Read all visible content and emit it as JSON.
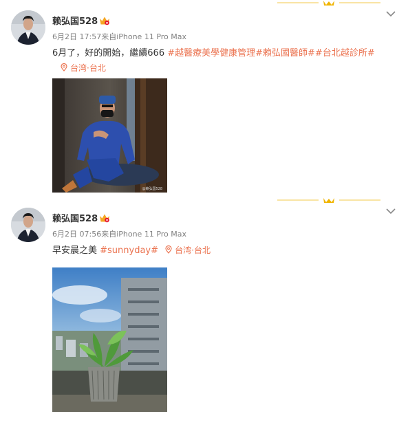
{
  "colors": {
    "accent": "#eb7350",
    "meta": "#808080",
    "text": "#333333",
    "gold": "#f0b400"
  },
  "posts": [
    {
      "username": "赖弘国528",
      "meta": "6月2日 17:57来自iPhone 11 Pro Max",
      "text": "6月了，好的開始，繼續666 ",
      "tags": [
        "#越醫療美學健康管理",
        "#賴弘國醫師#",
        "#台北越診所#"
      ],
      "location": "台湾·台北",
      "image_caption": "@赖弘国528",
      "icons": [
        "vip-crown-icon",
        "chevron-down-icon",
        "location-pin-icon"
      ]
    },
    {
      "username": "赖弘国528",
      "meta": "6月2日 07:56来自iPhone 11 Pro Max",
      "text": "早安晨之美 ",
      "tags": [
        "#sunnyday#"
      ],
      "location": "台湾·台北",
      "icons": [
        "vip-crown-icon",
        "chevron-down-icon",
        "location-pin-icon"
      ]
    }
  ]
}
